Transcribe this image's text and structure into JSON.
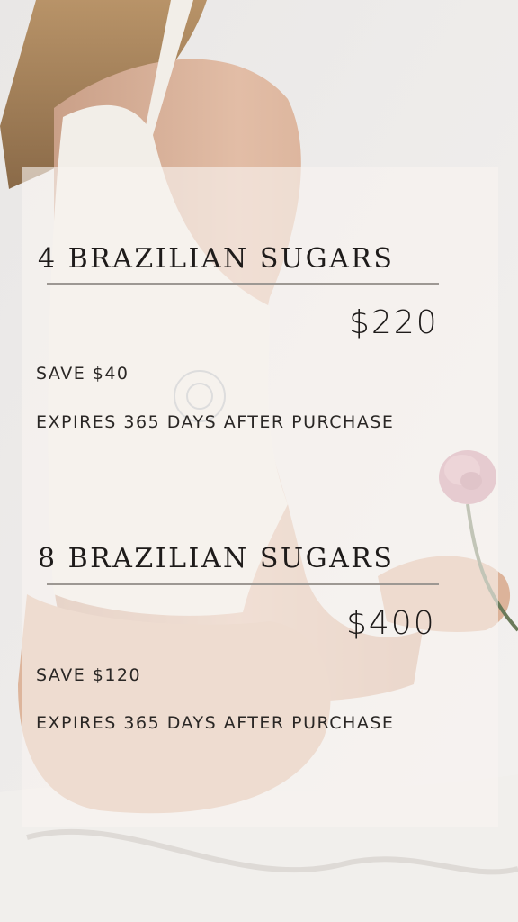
{
  "packages": [
    {
      "title": "4 BRAZILIAN SUGARS",
      "price": "$220",
      "save": "SAVE $40",
      "expires": "EXPIRES 365 DAYS AFTER PURCHASE"
    },
    {
      "title": "8 BRAZILIAN SUGARS",
      "price": "$400",
      "save": "SAVE $120",
      "expires": "EXPIRES 365 DAYS AFTER PURCHASE"
    }
  ],
  "colors": {
    "panel": "#f8f4f1",
    "text": "#1e1b1a",
    "divider": "#9d9893",
    "rose": "#c98a9b"
  },
  "background_photo": "woman-in-white-bodysuit-holding-rose"
}
